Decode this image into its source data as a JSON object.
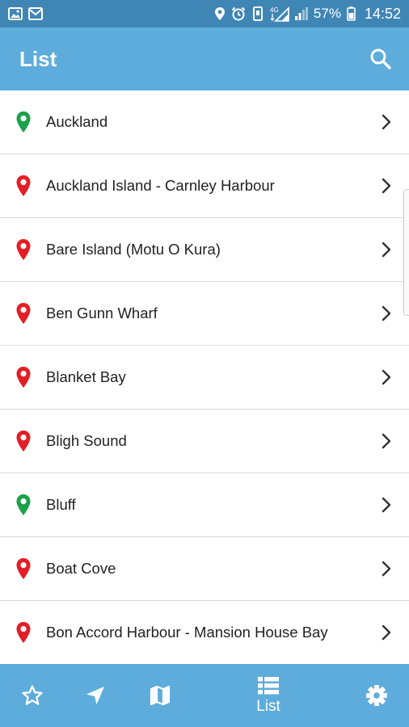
{
  "status_bar": {
    "battery": "57%",
    "time": "14:52",
    "icons": [
      "image-icon",
      "email-icon",
      "location-icon",
      "alarm-icon",
      "vibrate-icon",
      "4g-signal-icon",
      "signal-icon",
      "battery-icon"
    ]
  },
  "app_bar": {
    "title": "List",
    "search_icon": "search-icon"
  },
  "colors": {
    "app_bar": "#5dacdc",
    "status_bar": "#3f86b5",
    "pin_green": "#1aa14a",
    "pin_red": "#e41e26"
  },
  "locations": [
    {
      "name": "Auckland",
      "pin": "green"
    },
    {
      "name": "Auckland Island - Carnley Harbour",
      "pin": "red"
    },
    {
      "name": "Bare Island (Motu O Kura)",
      "pin": "red"
    },
    {
      "name": "Ben Gunn Wharf",
      "pin": "red"
    },
    {
      "name": "Blanket Bay",
      "pin": "red"
    },
    {
      "name": "Bligh Sound",
      "pin": "red"
    },
    {
      "name": "Bluff",
      "pin": "green"
    },
    {
      "name": "Boat Cove",
      "pin": "red"
    },
    {
      "name": "Bon Accord Harbour - Mansion House Bay",
      "pin": "red"
    }
  ],
  "bottom_nav": {
    "items": [
      {
        "icon": "star-icon"
      },
      {
        "icon": "navigation-arrow-icon"
      },
      {
        "icon": "map-icon"
      },
      {
        "icon": "list-icon",
        "label": "List",
        "active": true
      },
      {
        "icon": "gear-icon"
      }
    ]
  }
}
